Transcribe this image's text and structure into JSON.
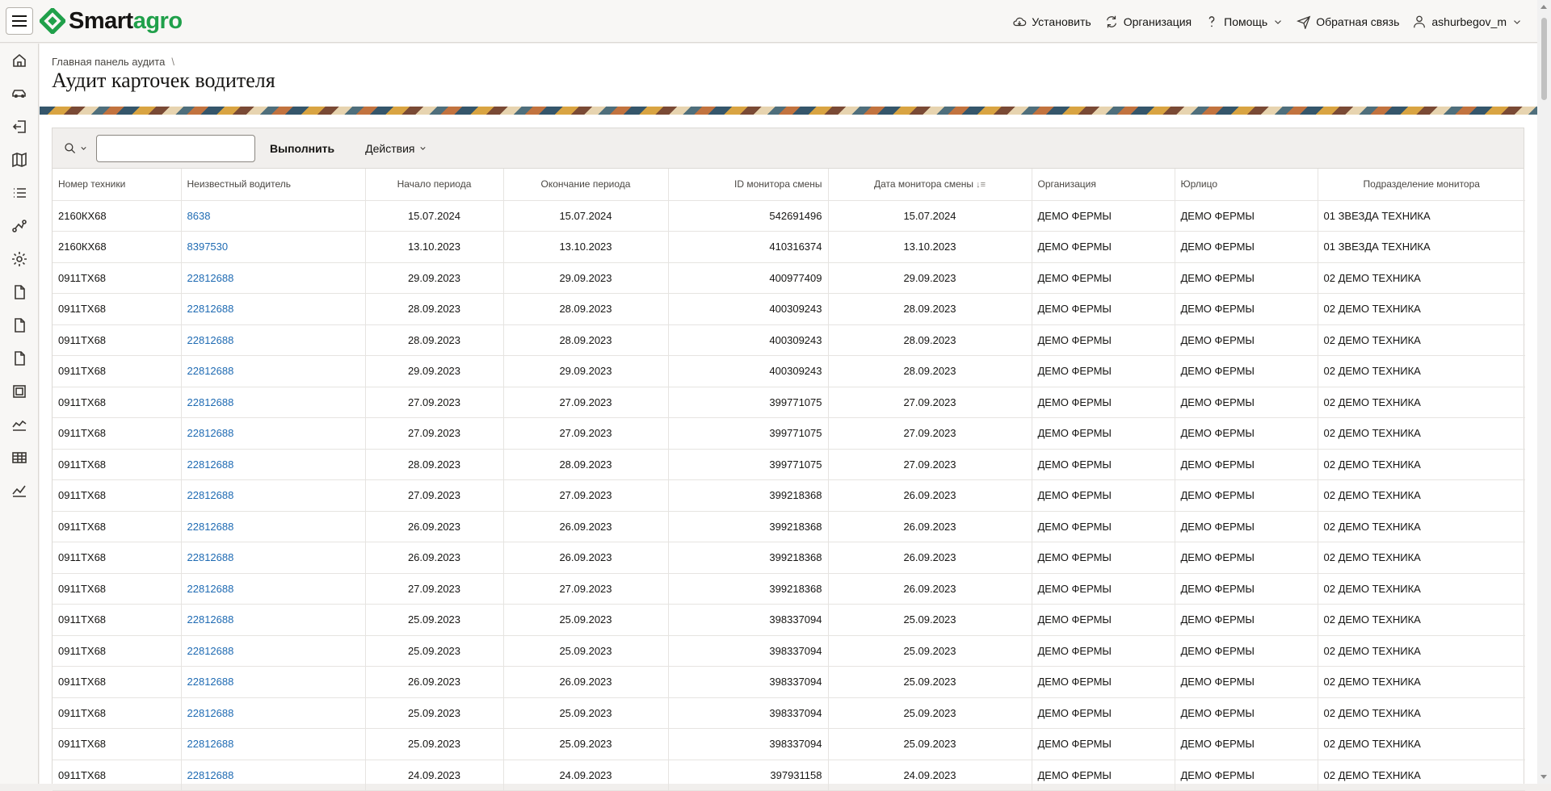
{
  "brand": {
    "part1": "Smart",
    "part2": "agro"
  },
  "header_actions": [
    {
      "icon": "cloud-install-icon",
      "label": "Установить"
    },
    {
      "icon": "sync-org-icon",
      "label": "Организация"
    },
    {
      "icon": "help-icon",
      "label": "Помощь"
    },
    {
      "icon": "send-feedback-icon",
      "label": "Обратная связь"
    },
    {
      "icon": "user-icon",
      "label": "ashurbegov_m"
    }
  ],
  "breadcrumb": {
    "parent": "Главная панель аудита",
    "separator": "\\"
  },
  "page_title": "Аудит карточек водителя",
  "toolbar": {
    "search_placeholder": "",
    "run_label": "Выполнить",
    "actions_label": "Действия"
  },
  "columns": [
    "Номер техники",
    "Неизвестный водитель",
    "Начало периода",
    "Окончание периода",
    "ID монитора смены",
    "Дата монитора смены",
    "Организация",
    "Юрлицо",
    "Подразделение монитора"
  ],
  "rows": [
    [
      "2160КХ68",
      "8638",
      "15.07.2024",
      "15.07.2024",
      "542691496",
      "15.07.2024",
      "ДЕМО ФЕРМЫ",
      "ДЕМО ФЕРМЫ",
      "01 ЗВЕЗДА ТЕХНИКА"
    ],
    [
      "2160КХ68",
      "8397530",
      "13.10.2023",
      "13.10.2023",
      "410316374",
      "13.10.2023",
      "ДЕМО ФЕРМЫ",
      "ДЕМО ФЕРМЫ",
      "01 ЗВЕЗДА ТЕХНИКА"
    ],
    [
      "0911ТХ68",
      "22812688",
      "29.09.2023",
      "29.09.2023",
      "400977409",
      "29.09.2023",
      "ДЕМО ФЕРМЫ",
      "ДЕМО ФЕРМЫ",
      "02 ДЕМО ТЕХНИКА"
    ],
    [
      "0911ТХ68",
      "22812688",
      "28.09.2023",
      "28.09.2023",
      "400309243",
      "28.09.2023",
      "ДЕМО ФЕРМЫ",
      "ДЕМО ФЕРМЫ",
      "02 ДЕМО ТЕХНИКА"
    ],
    [
      "0911ТХ68",
      "22812688",
      "28.09.2023",
      "28.09.2023",
      "400309243",
      "28.09.2023",
      "ДЕМО ФЕРМЫ",
      "ДЕМО ФЕРМЫ",
      "02 ДЕМО ТЕХНИКА"
    ],
    [
      "0911ТХ68",
      "22812688",
      "29.09.2023",
      "29.09.2023",
      "400309243",
      "28.09.2023",
      "ДЕМО ФЕРМЫ",
      "ДЕМО ФЕРМЫ",
      "02 ДЕМО ТЕХНИКА"
    ],
    [
      "0911ТХ68",
      "22812688",
      "27.09.2023",
      "27.09.2023",
      "399771075",
      "27.09.2023",
      "ДЕМО ФЕРМЫ",
      "ДЕМО ФЕРМЫ",
      "02 ДЕМО ТЕХНИКА"
    ],
    [
      "0911ТХ68",
      "22812688",
      "27.09.2023",
      "27.09.2023",
      "399771075",
      "27.09.2023",
      "ДЕМО ФЕРМЫ",
      "ДЕМО ФЕРМЫ",
      "02 ДЕМО ТЕХНИКА"
    ],
    [
      "0911ТХ68",
      "22812688",
      "28.09.2023",
      "28.09.2023",
      "399771075",
      "27.09.2023",
      "ДЕМО ФЕРМЫ",
      "ДЕМО ФЕРМЫ",
      "02 ДЕМО ТЕХНИКА"
    ],
    [
      "0911ТХ68",
      "22812688",
      "27.09.2023",
      "27.09.2023",
      "399218368",
      "26.09.2023",
      "ДЕМО ФЕРМЫ",
      "ДЕМО ФЕРМЫ",
      "02 ДЕМО ТЕХНИКА"
    ],
    [
      "0911ТХ68",
      "22812688",
      "26.09.2023",
      "26.09.2023",
      "399218368",
      "26.09.2023",
      "ДЕМО ФЕРМЫ",
      "ДЕМО ФЕРМЫ",
      "02 ДЕМО ТЕХНИКА"
    ],
    [
      "0911ТХ68",
      "22812688",
      "26.09.2023",
      "26.09.2023",
      "399218368",
      "26.09.2023",
      "ДЕМО ФЕРМЫ",
      "ДЕМО ФЕРМЫ",
      "02 ДЕМО ТЕХНИКА"
    ],
    [
      "0911ТХ68",
      "22812688",
      "27.09.2023",
      "27.09.2023",
      "399218368",
      "26.09.2023",
      "ДЕМО ФЕРМЫ",
      "ДЕМО ФЕРМЫ",
      "02 ДЕМО ТЕХНИКА"
    ],
    [
      "0911ТХ68",
      "22812688",
      "25.09.2023",
      "25.09.2023",
      "398337094",
      "25.09.2023",
      "ДЕМО ФЕРМЫ",
      "ДЕМО ФЕРМЫ",
      "02 ДЕМО ТЕХНИКА"
    ],
    [
      "0911ТХ68",
      "22812688",
      "25.09.2023",
      "25.09.2023",
      "398337094",
      "25.09.2023",
      "ДЕМО ФЕРМЫ",
      "ДЕМО ФЕРМЫ",
      "02 ДЕМО ТЕХНИКА"
    ],
    [
      "0911ТХ68",
      "22812688",
      "26.09.2023",
      "26.09.2023",
      "398337094",
      "25.09.2023",
      "ДЕМО ФЕРМЫ",
      "ДЕМО ФЕРМЫ",
      "02 ДЕМО ТЕХНИКА"
    ],
    [
      "0911ТХ68",
      "22812688",
      "25.09.2023",
      "25.09.2023",
      "398337094",
      "25.09.2023",
      "ДЕМО ФЕРМЫ",
      "ДЕМО ФЕРМЫ",
      "02 ДЕМО ТЕХНИКА"
    ],
    [
      "0911ТХ68",
      "22812688",
      "25.09.2023",
      "25.09.2023",
      "398337094",
      "25.09.2023",
      "ДЕМО ФЕРМЫ",
      "ДЕМО ФЕРМЫ",
      "02 ДЕМО ТЕХНИКА"
    ],
    [
      "0911ТХ68",
      "22812688",
      "24.09.2023",
      "24.09.2023",
      "397931158",
      "24.09.2023",
      "ДЕМО ФЕРМЫ",
      "ДЕМО ФЕРМЫ",
      "02 ДЕМО ТЕХНИКА"
    ]
  ],
  "sidebar_icons": [
    "home-icon",
    "car-icon",
    "sign-in-icon",
    "map-icon",
    "list-icon",
    "route-icon",
    "settings-icon",
    "document-icon",
    "document-icon-2",
    "document-icon-3",
    "frame-icon",
    "area-chart-icon",
    "table-icon",
    "line-chart-icon"
  ],
  "colors": {
    "brand_green": "#20a04a",
    "link": "#1f6bb3",
    "header_bg": "#f8f7f5"
  }
}
